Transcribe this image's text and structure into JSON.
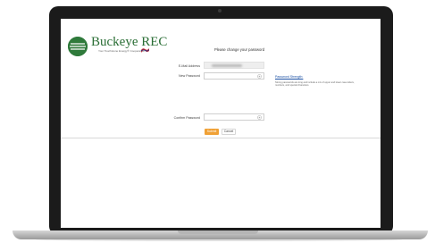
{
  "brand": {
    "name": "Buckeye REC",
    "tagline": "Your Touchstone Energy® Cooperative",
    "logo_color": "#2a6e35"
  },
  "form": {
    "title": "Please change your password",
    "email_label": "E-Mail Address",
    "new_password_label": "New Password",
    "confirm_password_label": "Confirm Password",
    "submit_label": "Submit",
    "cancel_label": "Cancel",
    "submit_color": "#f0a136"
  },
  "strength": {
    "link_text": "Password Strength:",
    "hint": "Strong passwords are long and include a mix of upper and lower case letters, numbers, and special characters."
  }
}
